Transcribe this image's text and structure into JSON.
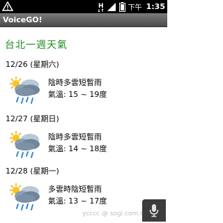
{
  "status_bar": {
    "ampm": "下午",
    "time": "1:35"
  },
  "app": {
    "title": "VoiceGO!"
  },
  "page": {
    "heading": "台北一週天氣"
  },
  "days": [
    {
      "date": "12/26 (星期六)",
      "condition": "陰時多雲短暫雨",
      "temperature": "氣溫: 15 ~ 19度",
      "icon": "cloudy-sun-rain-icon"
    },
    {
      "date": "12/27 (星期日)",
      "condition": "陰時多雲短暫雨",
      "temperature": "氣溫: 14 ~ 18度",
      "icon": "cloudy-sun-rain-icon"
    },
    {
      "date": "12/28 (星期一)",
      "condition": "多雲時陰短暫雨",
      "temperature": "氣溫: 13 ~ 17度",
      "icon": "cloudy-sun-rain-icon"
    }
  ],
  "watermark": "ycccc @ sogi.com.tw",
  "colors": {
    "heading": "#1e8c1e",
    "title_bar": "#5a5a5a",
    "status_bar": "#000000"
  }
}
